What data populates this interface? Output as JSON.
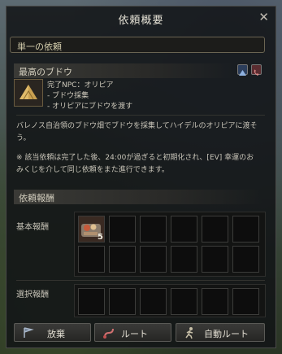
{
  "window": {
    "title": "依頼概要"
  },
  "header_bar": {
    "label": "単一の依頼"
  },
  "quest": {
    "name": "最高のブドウ",
    "complete_npc": "完了NPC：オリピア",
    "objectives": [
      "- ブドウ採集",
      "- オリピアにブドウを渡す"
    ],
    "description": "バレノス自治領のブドウ畑でブドウを採集してハイデルのオリピアに渡そう。",
    "note": "※ 該当依頼は完了した後、24:00が過ぎると初期化され、[EV] 幸運のおみくじを介して同じ依頼をまた進行できます。"
  },
  "rewards": {
    "section_title": "依頼報酬",
    "basic_label": "基本報酬",
    "select_label": "選択報酬",
    "basic_item_qty": "5"
  },
  "buttons": {
    "abandon": "放棄",
    "route": "ルート",
    "auto_route": "自動ルート"
  }
}
